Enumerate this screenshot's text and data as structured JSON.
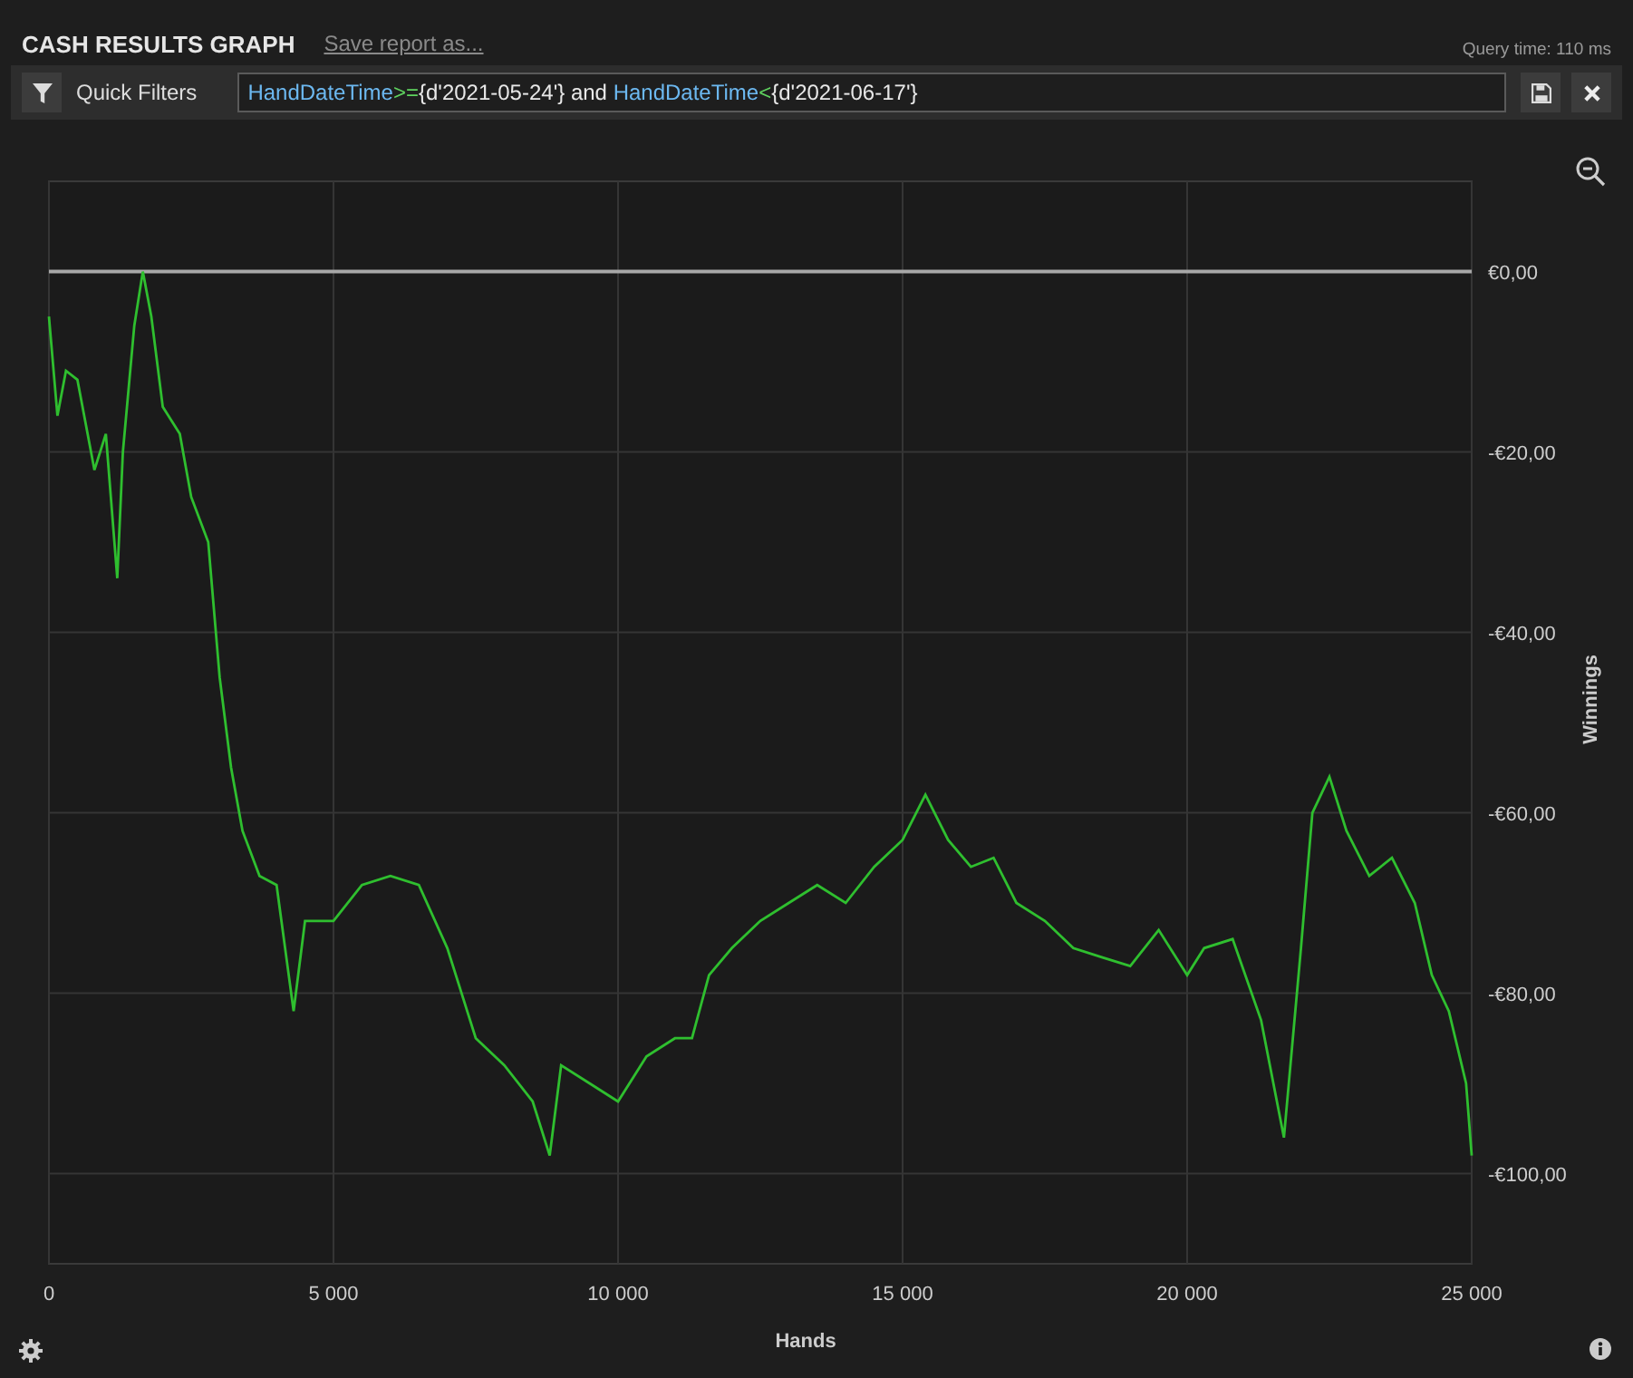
{
  "header": {
    "title": "CASH RESULTS GRAPH",
    "save_link": "Save report as...",
    "query_time": "Query time: 110 ms"
  },
  "quick_filters": {
    "label": "Quick Filters",
    "tokens": [
      {
        "kind": "field",
        "text": "HandDateTime"
      },
      {
        "kind": "operator",
        "text": ">="
      },
      {
        "kind": "literal",
        "text": "{d'2021-05-24'} and "
      },
      {
        "kind": "field",
        "text": "HandDateTime"
      },
      {
        "kind": "operator",
        "text": "<"
      },
      {
        "kind": "literal",
        "text": "{d'2021-06-17'}"
      }
    ]
  },
  "chart": {
    "chart_data": {
      "type": "line",
      "grid": true,
      "xlabel": "Hands",
      "ylabel": "Winnings",
      "xlim": [
        0,
        25000
      ],
      "ylim": [
        -110,
        10
      ],
      "xticks": [
        {
          "value": 0,
          "label": "0"
        },
        {
          "value": 5000,
          "label": "5 000"
        },
        {
          "value": 10000,
          "label": "10 000"
        },
        {
          "value": 15000,
          "label": "15 000"
        },
        {
          "value": 20000,
          "label": "20 000"
        },
        {
          "value": 25000,
          "label": "25 000"
        }
      ],
      "yticks": [
        {
          "value": 0,
          "label": "€0,00"
        },
        {
          "value": -20,
          "label": "-€20,00"
        },
        {
          "value": -40,
          "label": "-€40,00"
        },
        {
          "value": -60,
          "label": "-€60,00"
        },
        {
          "value": -80,
          "label": "-€80,00"
        },
        {
          "value": -100,
          "label": "-€100,00"
        }
      ],
      "x": [
        0,
        150,
        300,
        500,
        800,
        1000,
        1200,
        1300,
        1500,
        1650,
        1800,
        2000,
        2300,
        2500,
        2800,
        3000,
        3200,
        3400,
        3700,
        4000,
        4300,
        4500,
        5000,
        5500,
        6000,
        6500,
        7000,
        7500,
        8000,
        8500,
        8800,
        9000,
        9500,
        10000,
        10500,
        11000,
        11300,
        11600,
        12000,
        12500,
        13000,
        13500,
        14000,
        14500,
        15000,
        15400,
        15800,
        16200,
        16600,
        17000,
        17500,
        18000,
        18500,
        19000,
        19500,
        20000,
        20300,
        20800,
        21300,
        21700,
        22000,
        22200,
        22500,
        22800,
        23200,
        23600,
        24000,
        24300,
        24600,
        24900,
        25000
      ],
      "series": [
        {
          "color": "#2fbf2f",
          "values": [
            -5,
            -16,
            -11,
            -12,
            -22,
            -18,
            -34,
            -20,
            -6,
            0,
            -5,
            -15,
            -18,
            -25,
            -30,
            -45,
            -55,
            -62,
            -67,
            -68,
            -82,
            -72,
            -72,
            -68,
            -67,
            -68,
            -75,
            -85,
            -88,
            -92,
            -98,
            -88,
            -90,
            -92,
            -87,
            -85,
            -85,
            -78,
            -75,
            -72,
            -70,
            -68,
            -70,
            -66,
            -63,
            -58,
            -63,
            -66,
            -65,
            -70,
            -72,
            -75,
            -76,
            -77,
            -73,
            -78,
            -75,
            -74,
            -83,
            -96,
            -75,
            -60,
            -56,
            -62,
            -67,
            -65,
            -70,
            -78,
            -82,
            -90,
            -98
          ]
        }
      ]
    }
  }
}
